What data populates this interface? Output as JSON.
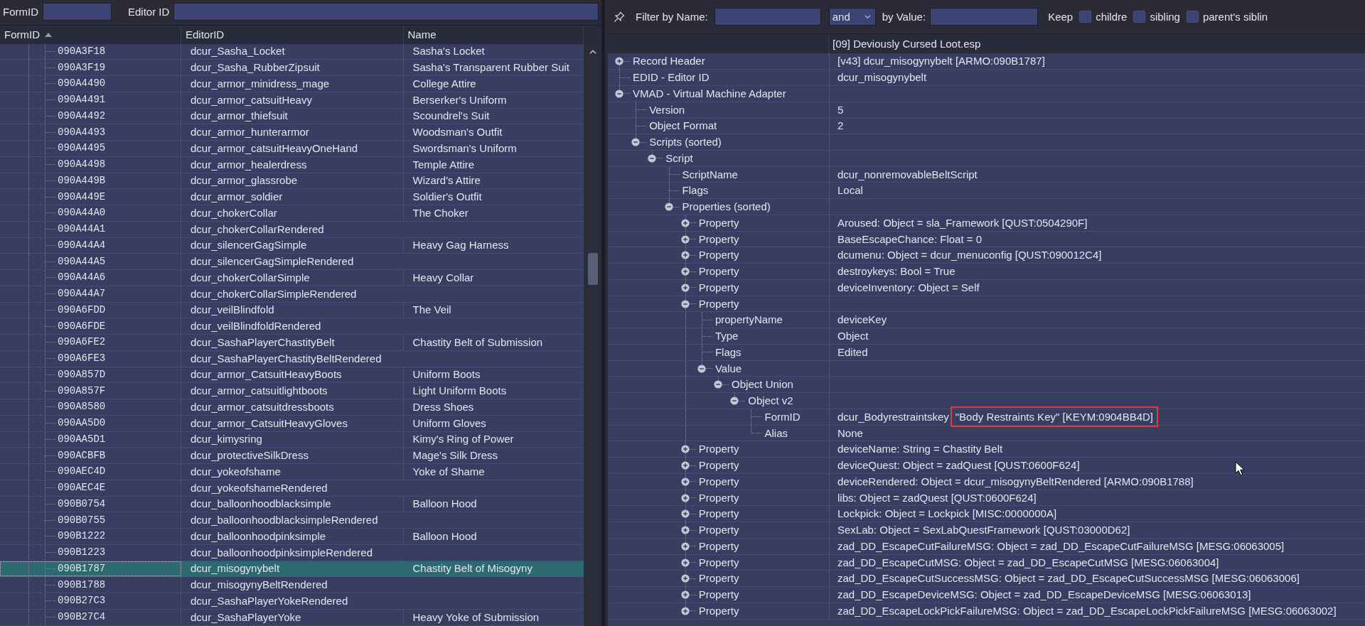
{
  "left_filter": {
    "formid_label": "FormID",
    "editorid_label": "Editor ID"
  },
  "records_table": {
    "columns": [
      {
        "label": "FormID",
        "sorted": true
      },
      {
        "label": "EditorID",
        "sorted": false
      },
      {
        "label": "Name",
        "sorted": false
      }
    ],
    "rows": [
      {
        "form_id": "090A3F18",
        "editor_id": "dcur_Sasha_Locket",
        "name": "Sasha's Locket",
        "selected": false
      },
      {
        "form_id": "090A3F19",
        "editor_id": "dcur_Sasha_RubberZipsuit",
        "name": "Sasha's Transparent Rubber Suit",
        "selected": false
      },
      {
        "form_id": "090A4490",
        "editor_id": "dcur_armor_minidress_mage",
        "name": "College Attire",
        "selected": false
      },
      {
        "form_id": "090A4491",
        "editor_id": "dcur_armor_catsuitHeavy",
        "name": "Berserker's Uniform",
        "selected": false
      },
      {
        "form_id": "090A4492",
        "editor_id": "dcur_armor_thiefsuit",
        "name": "Scoundrel's Suit",
        "selected": false
      },
      {
        "form_id": "090A4493",
        "editor_id": "dcur_armor_hunterarmor",
        "name": "Woodsman's Outfit",
        "selected": false
      },
      {
        "form_id": "090A4495",
        "editor_id": "dcur_armor_catsuitHeavyOneHand",
        "name": "Swordsman's Uniform",
        "selected": false
      },
      {
        "form_id": "090A4498",
        "editor_id": "dcur_armor_healerdress",
        "name": "Temple Attire",
        "selected": false
      },
      {
        "form_id": "090A449B",
        "editor_id": "dcur_armor_glassrobe",
        "name": "Wizard's Attire",
        "selected": false
      },
      {
        "form_id": "090A449E",
        "editor_id": "dcur_armor_soldier",
        "name": "Soldier's Outfit",
        "selected": false
      },
      {
        "form_id": "090A44A0",
        "editor_id": "dcur_chokerCollar",
        "name": "The Choker",
        "selected": false
      },
      {
        "form_id": "090A44A1",
        "editor_id": "dcur_chokerCollarRendered",
        "selected": false
      },
      {
        "form_id": "090A44A4",
        "editor_id": "dcur_silencerGagSimple",
        "name": "Heavy Gag Harness",
        "selected": false
      },
      {
        "form_id": "090A44A5",
        "editor_id": "dcur_silencerGagSimpleRendered",
        "selected": false
      },
      {
        "form_id": "090A44A6",
        "editor_id": "dcur_chokerCollarSimple",
        "name": "Heavy Collar",
        "selected": false
      },
      {
        "form_id": "090A44A7",
        "editor_id": "dcur_chokerCollarSimpleRendered",
        "selected": false
      },
      {
        "form_id": "090A6FDD",
        "editor_id": "dcur_veilBlindfold",
        "name": "The Veil",
        "selected": false
      },
      {
        "form_id": "090A6FDE",
        "editor_id": "dcur_veilBlindfoldRendered",
        "selected": false
      },
      {
        "form_id": "090A6FE2",
        "editor_id": "dcur_SashaPlayerChastityBelt",
        "name": "Chastity Belt of Submission",
        "selected": false
      },
      {
        "form_id": "090A6FE3",
        "editor_id": "dcur_SashaPlayerChastityBeltRendered",
        "selected": false
      },
      {
        "form_id": "090A857D",
        "editor_id": "dcur_armor_CatsuitHeavyBoots",
        "name": "Uniform Boots",
        "selected": false
      },
      {
        "form_id": "090A857F",
        "editor_id": "dcur_armor_catsuitlightboots",
        "name": "Light Uniform Boots",
        "selected": false
      },
      {
        "form_id": "090A8580",
        "editor_id": "dcur_armor_catsuitdressboots",
        "name": "Dress Shoes",
        "selected": false
      },
      {
        "form_id": "090AA5D0",
        "editor_id": "dcur_armor_CatsuitHeavyGloves",
        "name": "Uniform Gloves",
        "selected": false
      },
      {
        "form_id": "090AA5D1",
        "editor_id": "dcur_kimysring",
        "name": "Kimy's Ring of Power",
        "selected": false
      },
      {
        "form_id": "090ACBFB",
        "editor_id": "dcur_protectiveSilkDress",
        "name": "Mage's Silk Dress",
        "selected": false
      },
      {
        "form_id": "090AEC4D",
        "editor_id": "dcur_yokeofshame",
        "name": "Yoke of Shame",
        "selected": false
      },
      {
        "form_id": "090AEC4E",
        "editor_id": "dcur_yokeofshameRendered",
        "selected": false
      },
      {
        "form_id": "090B0754",
        "editor_id": "dcur_balloonhoodblacksimple",
        "name": "Balloon Hood",
        "selected": false
      },
      {
        "form_id": "090B0755",
        "editor_id": "dcur_balloonhoodblacksimpleRendered",
        "selected": false
      },
      {
        "form_id": "090B1222",
        "editor_id": "dcur_balloonhoodpinksimple",
        "name": "Balloon Hood",
        "selected": false
      },
      {
        "form_id": "090B1223",
        "editor_id": "dcur_balloonhoodpinksimpleRendered",
        "selected": false
      },
      {
        "form_id": "090B1787",
        "editor_id": "dcur_misogynybelt",
        "name": "Chastity Belt of Misogyny",
        "selected": true
      },
      {
        "form_id": "090B1788",
        "editor_id": "dcur_misogynyBeltRendered",
        "selected": false
      },
      {
        "form_id": "090B27C3",
        "editor_id": "dcur_SashaPlayerYokeRendered",
        "selected": false
      },
      {
        "form_id": "090B27C4",
        "editor_id": "dcur_SashaPlayerYoke",
        "name": "Heavy Yoke of Submission",
        "selected": false
      }
    ]
  },
  "filter_bar": {
    "name_label": "Filter by Name:",
    "operator": "and",
    "value_label": "by Value:",
    "keep_label": "Keep",
    "keep_options": [
      {
        "label": "childre",
        "checked": false
      },
      {
        "label": "sibling",
        "checked": false
      },
      {
        "label": "parent's siblin",
        "checked": false
      }
    ]
  },
  "record_view": {
    "file_column": "[09] Deviously Cursed Loot.esp",
    "tree": [
      {
        "label": "Record Header",
        "kind": "branch",
        "expanded": false,
        "value": "[v43] dcur_misogynybelt [ARMO:090B1787]"
      },
      {
        "label": "EDID - Editor ID",
        "kind": "leaf",
        "value": "dcur_misogynybelt"
      },
      {
        "label": "VMAD - Virtual Machine Adapter",
        "kind": "branch",
        "expanded": true,
        "children": [
          {
            "label": "Version",
            "kind": "leaf",
            "value": "5"
          },
          {
            "label": "Object Format",
            "kind": "leaf",
            "value": "2"
          },
          {
            "label": "Scripts (sorted)",
            "kind": "branch",
            "expanded": true,
            "children": [
              {
                "label": "Script",
                "kind": "branch",
                "expanded": true,
                "children": [
                  {
                    "label": "ScriptName",
                    "kind": "leaf",
                    "value": "dcur_nonremovableBeltScript"
                  },
                  {
                    "label": "Flags",
                    "kind": "leaf",
                    "value": "Local"
                  },
                  {
                    "label": "Properties (sorted)",
                    "kind": "branch",
                    "expanded": true,
                    "children": [
                      {
                        "label": "Property",
                        "kind": "branch",
                        "expanded": false,
                        "value": "Aroused: Object = sla_Framework [QUST:0504290F]"
                      },
                      {
                        "label": "Property",
                        "kind": "branch",
                        "expanded": false,
                        "value": "BaseEscapeChance: Float = 0"
                      },
                      {
                        "label": "Property",
                        "kind": "branch",
                        "expanded": false,
                        "value": "dcumenu: Object = dcur_menuconfig [QUST:090012C4]"
                      },
                      {
                        "label": "Property",
                        "kind": "branch",
                        "expanded": false,
                        "value": "destroykeys: Bool = True"
                      },
                      {
                        "label": "Property",
                        "kind": "branch",
                        "expanded": false,
                        "value": "deviceInventory: Object = Self"
                      },
                      {
                        "label": "Property",
                        "kind": "branch",
                        "expanded": true,
                        "children": [
                          {
                            "label": "propertyName",
                            "kind": "leaf",
                            "value": "deviceKey"
                          },
                          {
                            "label": "Type",
                            "kind": "leaf",
                            "value": "Object"
                          },
                          {
                            "label": "Flags",
                            "kind": "leaf",
                            "value": "Edited"
                          },
                          {
                            "label": "Value",
                            "kind": "branch",
                            "expanded": true,
                            "children": [
                              {
                                "label": "Object Union",
                                "kind": "branch",
                                "expanded": true,
                                "children": [
                                  {
                                    "label": "Object v2",
                                    "kind": "branch",
                                    "expanded": true,
                                    "children": [
                                      {
                                        "label": "FormID",
                                        "kind": "leaf",
                                        "value": "dcur_Bodyrestraintskey",
                                        "highlight": "\"Body Restraints Key\" [KEYM:0904BB4D]"
                                      },
                                      {
                                        "label": "Alias",
                                        "kind": "leaf",
                                        "value": "None"
                                      }
                                    ]
                                  }
                                ]
                              }
                            ]
                          }
                        ]
                      },
                      {
                        "label": "Property",
                        "kind": "branch",
                        "expanded": false,
                        "value": "deviceName: String = Chastity Belt"
                      },
                      {
                        "label": "Property",
                        "kind": "branch",
                        "expanded": false,
                        "value": "deviceQuest: Object = zadQuest [QUST:0600F624]"
                      },
                      {
                        "label": "Property",
                        "kind": "branch",
                        "expanded": false,
                        "value": "deviceRendered: Object = dcur_misogynyBeltRendered [ARMO:090B1788]"
                      },
                      {
                        "label": "Property",
                        "kind": "branch",
                        "expanded": false,
                        "value": "libs: Object = zadQuest [QUST:0600F624]"
                      },
                      {
                        "label": "Property",
                        "kind": "branch",
                        "expanded": false,
                        "value": "Lockpick: Object = Lockpick [MISC:0000000A]"
                      },
                      {
                        "label": "Property",
                        "kind": "branch",
                        "expanded": false,
                        "value": "SexLab: Object = SexLabQuestFramework [QUST:03000D62]"
                      },
                      {
                        "label": "Property",
                        "kind": "branch",
                        "expanded": false,
                        "value": "zad_DD_EscapeCutFailureMSG: Object = zad_DD_EscapeCutFailureMSG [MESG:06063005]"
                      },
                      {
                        "label": "Property",
                        "kind": "branch",
                        "expanded": false,
                        "value": "zad_DD_EscapeCutMSG: Object = zad_DD_EscapeCutMSG [MESG:06063004]"
                      },
                      {
                        "label": "Property",
                        "kind": "branch",
                        "expanded": false,
                        "value": "zad_DD_EscapeCutSuccessMSG: Object = zad_DD_EscapeCutSuccessMSG [MESG:06063006]"
                      },
                      {
                        "label": "Property",
                        "kind": "branch",
                        "expanded": false,
                        "value": "zad_DD_EscapeDeviceMSG: Object = zad_DD_EscapeDeviceMSG [MESG:06063013]"
                      },
                      {
                        "label": "Property",
                        "kind": "branch",
                        "expanded": false,
                        "value": "zad_DD_EscapeLockPickFailureMSG: Object = zad_DD_EscapeLockPickFailureMSG [MESG:06063002]"
                      }
                    ]
                  }
                ]
              }
            ]
          }
        ]
      }
    ]
  }
}
